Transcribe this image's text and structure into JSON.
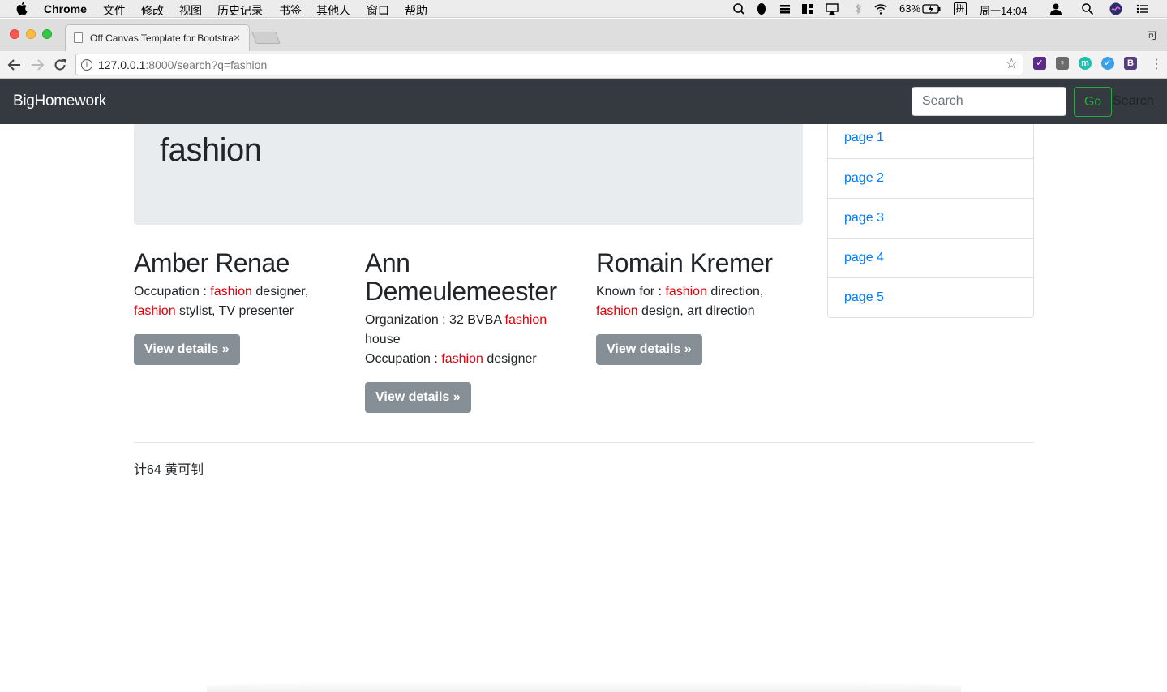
{
  "menubar": {
    "app_name": "Chrome",
    "menus": [
      "文件",
      "修改",
      "视图",
      "历史记录",
      "书签",
      "其他人",
      "窗口",
      "帮助"
    ],
    "battery": "63%",
    "input_method": "拼",
    "clock": "周一14:04"
  },
  "browser": {
    "tab_title": "Off Canvas Template for Bootstrap",
    "tab_close": "×",
    "corner_char": "可",
    "url_host": "127.0.0.1",
    "url_rest": ":8000/search?q=fashion",
    "extensions": [
      "check-extension",
      "lightbulb-extension",
      "m-extension",
      "feather-extension",
      "b-extension"
    ]
  },
  "navbar": {
    "brand": "BigHomework",
    "search_placeholder": "Search",
    "go_label": "Go",
    "search_text": "Search"
  },
  "jumbotron": {
    "query": "fashion"
  },
  "results": [
    {
      "name": "Amber Renae",
      "lines": [
        [
          {
            "t": "Occupation : "
          },
          {
            "t": "fashion",
            "hl": true
          },
          {
            "t": " designer, "
          },
          {
            "t": "fashion",
            "hl": true
          },
          {
            "t": " stylist, TV presenter"
          }
        ]
      ],
      "button": "View details »"
    },
    {
      "name": "Ann Demeulemeester",
      "lines": [
        [
          {
            "t": "Organization : 32 BVBA "
          },
          {
            "t": "fashion",
            "hl": true
          },
          {
            "t": " house"
          }
        ],
        [
          {
            "t": "Occupation : "
          },
          {
            "t": "fashion",
            "hl": true
          },
          {
            "t": " designer"
          }
        ]
      ],
      "button": "View details »"
    },
    {
      "name": "Romain Kremer",
      "lines": [
        [
          {
            "t": "Known for : "
          },
          {
            "t": "fashion",
            "hl": true
          },
          {
            "t": " direction, "
          },
          {
            "t": "fashion",
            "hl": true
          },
          {
            "t": " design, art direction"
          }
        ]
      ],
      "button": "View details »"
    }
  ],
  "pages": [
    "page 1",
    "page 2",
    "page 3",
    "page 4",
    "page 5"
  ],
  "footer": {
    "text": "计64 黄可钊"
  },
  "colors": {
    "navbar_bg": "#343a40",
    "highlight": "#e0000a",
    "link": "#007bff",
    "button_gray": "#868e96",
    "go_green": "#28a745",
    "jumbotron_bg": "#e9ecef"
  }
}
